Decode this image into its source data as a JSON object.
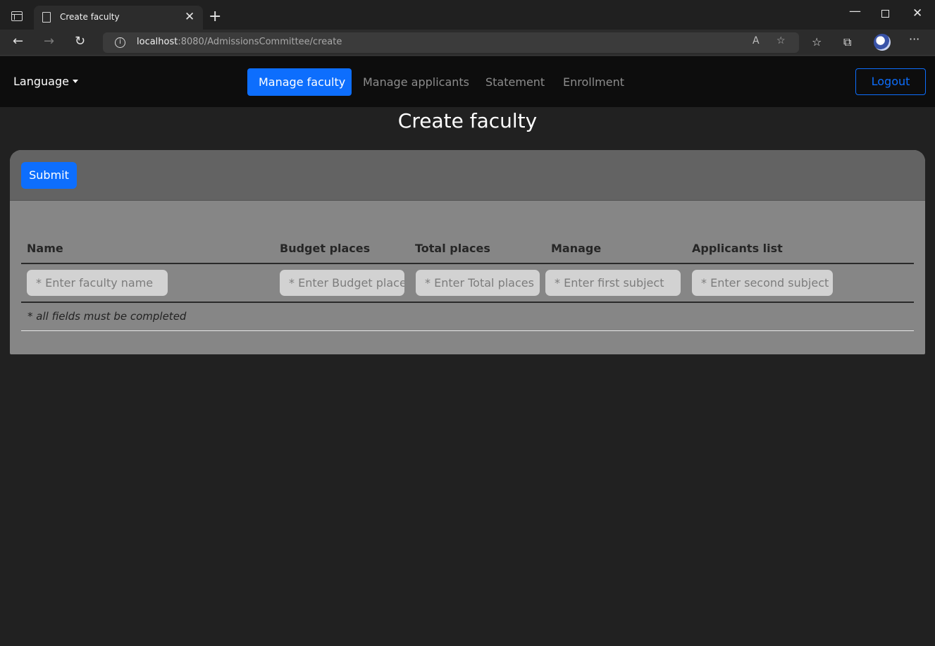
{
  "browser": {
    "tab_title": "Create faculty",
    "tab_close": "✕",
    "new_tab": "+",
    "window": {
      "minimize": "—",
      "close": "✕"
    },
    "nav": {
      "back": "←",
      "forward": "→",
      "refresh": "↻"
    },
    "url_host": "localhost",
    "url_rest": ":8080/AdmissionsCommittee/create",
    "info_glyph": "i",
    "read_aloud": "A",
    "add_favorite": "☆",
    "favorites": "☆",
    "collections": "⧉",
    "more": "···"
  },
  "navbar": {
    "language": "Language",
    "links": [
      {
        "label": "Manage faculty",
        "active": true
      },
      {
        "label": "Manage applicants",
        "active": false
      },
      {
        "label": "Statement",
        "active": false
      },
      {
        "label": "Enrollment",
        "active": false
      }
    ],
    "logout": "Logout"
  },
  "page": {
    "title": "Create faculty"
  },
  "form": {
    "submit": "Submit",
    "columns": [
      "Name",
      "Budget places",
      "Total places",
      "Manage",
      "Applicants list"
    ],
    "fields": [
      {
        "value": "",
        "placeholder": "* Enter faculty name"
      },
      {
        "value": "",
        "placeholder": "* Enter Budget places"
      },
      {
        "value": "",
        "placeholder": "* Enter Total places"
      },
      {
        "value": "",
        "placeholder": "* Enter first subject"
      },
      {
        "value": "",
        "placeholder": "* Enter second subject"
      }
    ],
    "note": "* all fields must be completed"
  },
  "colors": {
    "primary": "#0d6efd",
    "background": "#212121",
    "navbar_bg": "#0d0d0d",
    "card_header": "#636363",
    "card_body": "#868686"
  }
}
